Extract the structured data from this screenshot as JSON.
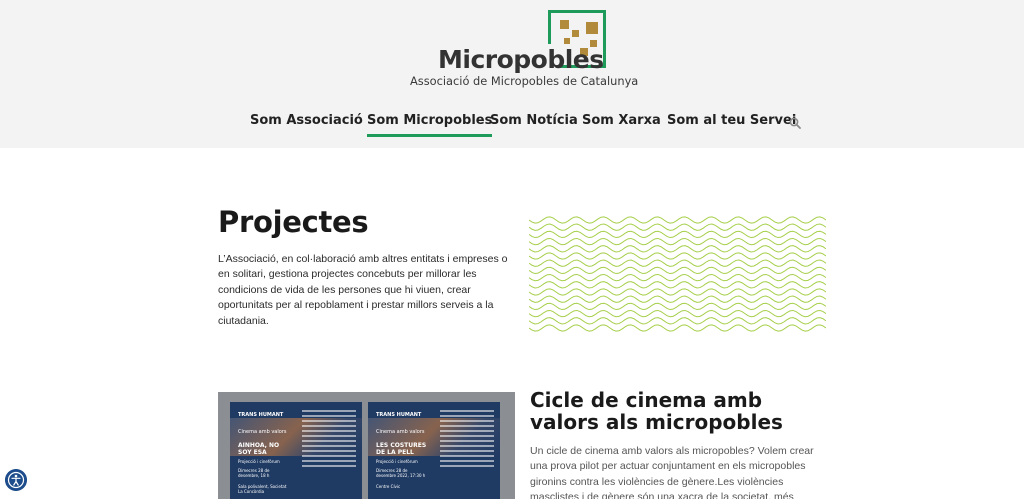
{
  "header": {
    "logo_title": "Micropobles",
    "logo_subtitle": "Associació de Micropobles de Catalunya",
    "logo_accent": "#1e9a5a",
    "logo_square_color": "#b28a3c"
  },
  "nav": {
    "items": [
      {
        "label": "Som Associació",
        "active": false
      },
      {
        "label": "Som Micropobles",
        "active": true
      },
      {
        "label": "Som Notícia",
        "active": false
      },
      {
        "label": "Som Xarxa",
        "active": false
      },
      {
        "label": "Som al teu Servei",
        "active": false
      }
    ],
    "search_icon": "search-icon"
  },
  "intro": {
    "title": "Projectes",
    "text": "L’Associació, en col·laboració amb altres entitats i empreses o en solitari, gestiona projectes concebuts per millorar les condicions de vida de les persones que hi viuen, crear oportunitats per al repoblament i prestar millors serveis a la ciutadania.",
    "wave_color": "#a6cf4a"
  },
  "card": {
    "title": "Cicle de cinema amb valors als micropobles",
    "text": "Un cicle de cinema amb valors als micropobles? Volem crear una prova pilot per actuar conjuntament en els micropobles gironins contra les violències de gènere.Les violències masclistes i de gènere són una xacra de la societat, més present del que moltes vegades podem",
    "posters": [
      {
        "brand": "TRANS HUMANT",
        "series": "Cinema amb valors",
        "film": "AINHOA, NO SOY ESA",
        "subtitle": "Projecció i cinefòrum",
        "date": "Dimecres 28 de desembre, 18 h",
        "place": "Sala polivalent, Societat La Concòrdia"
      },
      {
        "brand": "TRANS HUMANT",
        "series": "Cinema amb valors",
        "film": "LES COSTURES DE LA PELL",
        "subtitle": "Projecció i cinefòrum",
        "date": "Dimecres 28 de desembre 2022, 17:30 h",
        "place": "Centre Cívic"
      }
    ]
  },
  "accessibility_icon": "accessibility-icon"
}
